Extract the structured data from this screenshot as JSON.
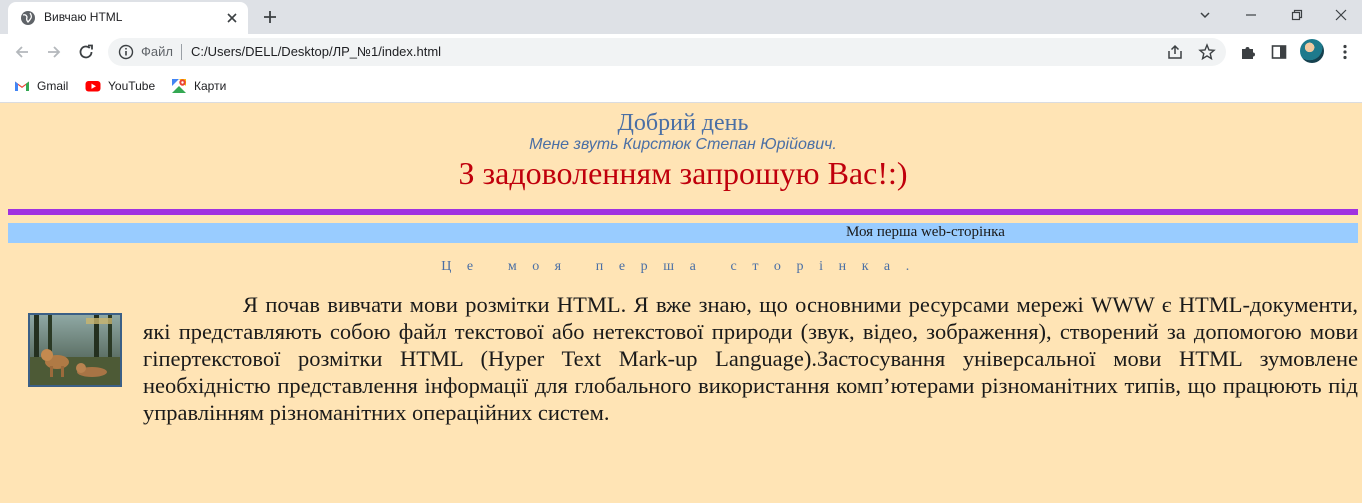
{
  "browser": {
    "tab_title": "Вивчаю HTML",
    "site_label": "Файл",
    "url": "C:/Users/DELL/Desktop/ЛР_№1/index.html",
    "bookmarks": [
      "Gmail",
      "YouTube",
      "Карти"
    ]
  },
  "page": {
    "greeting": "Добрий день",
    "name_line": "Мене звуть Кирстюк Степан Юрійович.",
    "invite": "З задоволенням запрошую Вас!:)",
    "banner": "Моя перша web-сторінка",
    "subtitle": "Це моя перша сторінка.",
    "paragraph": "Я почав вивчати мови розмітки HTML. Я вже знаю, що основними ресурсами мережі WWW є HTML-документи, які представляють собою файл текстової або нетекстової природи (звук, відео, зображення), створений за допомогою мови гіпертекстової розмітки HTML (Hyper Text Mark-up Language).Застосування універсальної мови HTML зумовлене необхідністю представлення інформації для глобального використання комп’ютерами різноманітних типів, що працюють під управлінням різноманітних операційних систем."
  },
  "colors": {
    "page_background": "#ffe4b5",
    "greeting": "#4a6fa5",
    "invite": "#c0000c",
    "rule": "#a031e0",
    "banner": "#99ccff"
  },
  "icons": [
    "globe-icon",
    "close-icon",
    "plus-icon",
    "chevron-down-icon",
    "minimize-icon",
    "restore-icon",
    "back-arrow-icon",
    "forward-arrow-icon",
    "reload-icon",
    "info-icon",
    "share-icon",
    "star-icon",
    "puzzle-icon",
    "side-panel-icon",
    "more-vert-icon",
    "gmail-icon",
    "youtube-icon",
    "maps-icon"
  ]
}
